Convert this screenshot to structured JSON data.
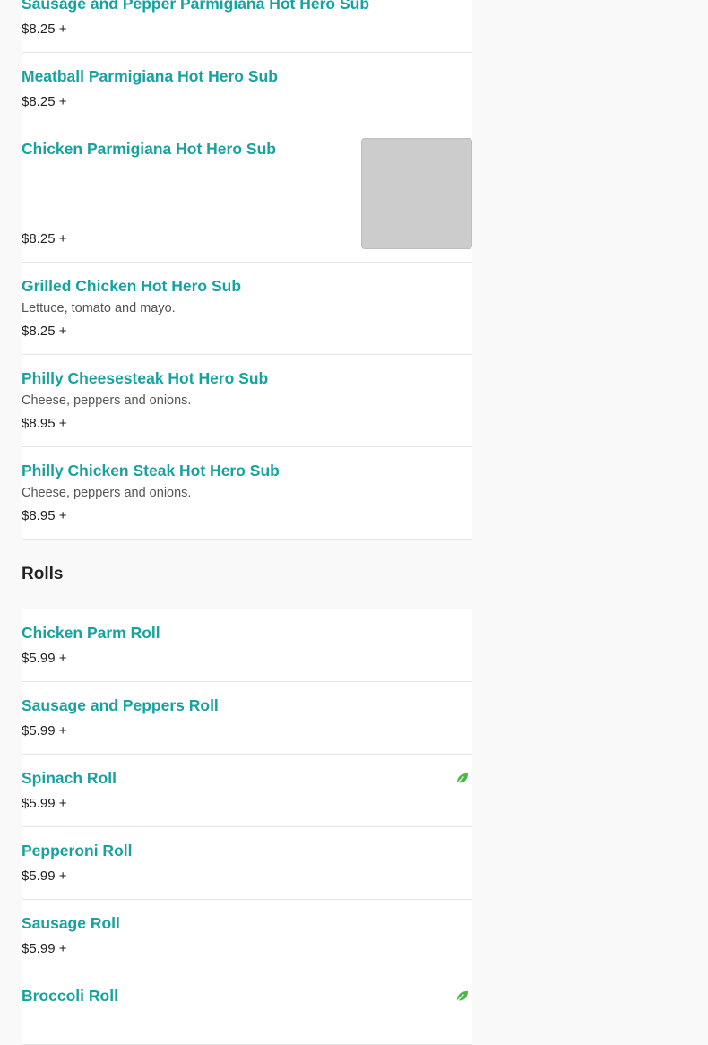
{
  "colors": {
    "item_name": "#17a2a0",
    "leaf": "#4cb848",
    "image_placeholder": "#cccccc"
  },
  "hero_items": [
    {
      "name": "Sausage and Pepper Parmigiana Hot Hero Sub",
      "price": "$8.25 +"
    },
    {
      "name": "Meatball Parmigiana Hot Hero Sub",
      "price": "$8.25 +"
    },
    {
      "name": "Chicken Parmigiana Hot Hero Sub",
      "price": "$8.25 +"
    },
    {
      "name": "Grilled Chicken Hot Hero Sub",
      "description": "Lettuce, tomato and mayo.",
      "price": "$8.25 +"
    },
    {
      "name": "Philly Cheesesteak Hot Hero Sub",
      "description": "Cheese, peppers and onions.",
      "price": "$8.95 +"
    },
    {
      "name": "Philly Chicken Steak Hot Hero Sub",
      "description": "Cheese, peppers and onions.",
      "price": "$8.95 +"
    }
  ],
  "rolls_section": {
    "title": "Rolls",
    "items": [
      {
        "name": "Chicken Parm Roll",
        "price": "$5.99 +"
      },
      {
        "name": "Sausage and Peppers Roll",
        "price": "$5.99 +"
      },
      {
        "name": "Spinach Roll",
        "price": "$5.99 +",
        "icon": "leaf-icon"
      },
      {
        "name": "Pepperoni Roll",
        "price": "$5.99 +"
      },
      {
        "name": "Sausage Roll",
        "price": "$5.99 +"
      },
      {
        "name": "Broccoli Roll",
        "icon": "leaf-icon"
      }
    ]
  }
}
